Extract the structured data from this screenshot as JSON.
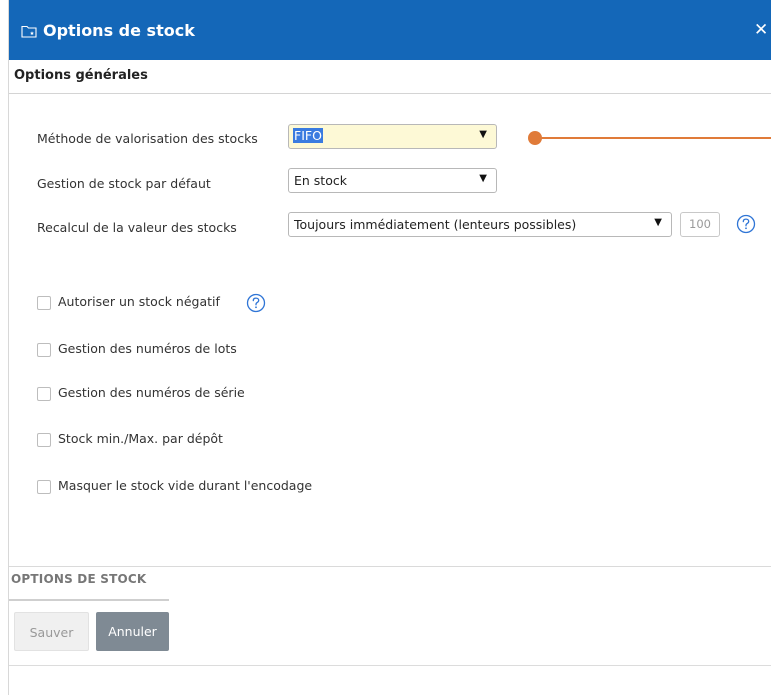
{
  "dialog": {
    "title": "Options de stock",
    "title_icon": "folder-star-icon",
    "close_label": "✕"
  },
  "general": {
    "section_title": "Options générales",
    "valuation": {
      "label": "Méthode de valorisation des stocks",
      "value": "FIFO"
    },
    "default_stock": {
      "label": "Gestion de stock par défaut",
      "value": "En stock"
    },
    "recalc": {
      "label": "Recalcul de la valeur des stocks",
      "value": "Toujours immédiatement (lenteurs possibles)",
      "number_placeholder": "100"
    },
    "help_icon": "question-circle-icon"
  },
  "checkboxes": [
    {
      "label": "Autoriser un stock négatif",
      "checked": false,
      "has_help": true
    },
    {
      "label": "Gestion des numéros de lots",
      "checked": false
    },
    {
      "label": "Gestion des numéros de série",
      "checked": false
    },
    {
      "label": "Stock min./Max. par dépôt",
      "checked": false
    },
    {
      "label": "Masquer le stock vide durant l'encodage",
      "checked": false
    }
  ],
  "footer": {
    "tab_title": "OPTIONS DE STOCK",
    "save_label": "Sauver",
    "cancel_label": "Annuler"
  },
  "colors": {
    "titlebar": "#1467b8",
    "accent_pointer": "#e07b39",
    "selection": "#3a7be0"
  }
}
